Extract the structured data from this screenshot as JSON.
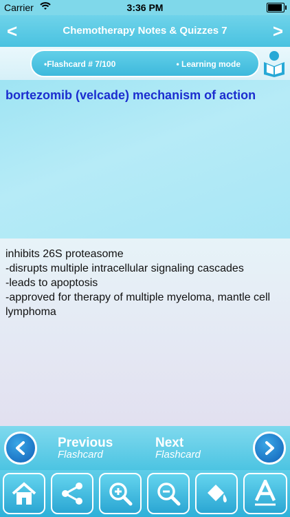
{
  "status": {
    "carrier": "Carrier",
    "time": "3:36 PM"
  },
  "nav": {
    "title": "Chemotherapy Notes & Quizzes 7",
    "back_icon": "chevron-left-icon",
    "forward_icon": "chevron-right-icon"
  },
  "info": {
    "flashcard_label": "•Flashcard #  7/100",
    "mode_label": "• Learning mode"
  },
  "card": {
    "question": "bortezomib (velcade) mechanism of action",
    "answer": "inhibits 26S proteasome\n-disrupts multiple intracellular signaling cascades\n-leads to apoptosis\n-approved for therapy of multiple myeloma, mantle cell lymphoma"
  },
  "nav_buttons": {
    "prev_title": "Previous",
    "prev_sub": "Flashcard",
    "next_title": "Next",
    "next_sub": "Flashcard"
  },
  "toolbar": [
    "home-icon",
    "share-icon",
    "zoom-in-icon",
    "zoom-out-icon",
    "paint-bucket-icon",
    "font-icon"
  ],
  "colors": {
    "accent": "#49c2e0",
    "question_text": "#1b2dcf",
    "button_blue": "#1060b8"
  }
}
